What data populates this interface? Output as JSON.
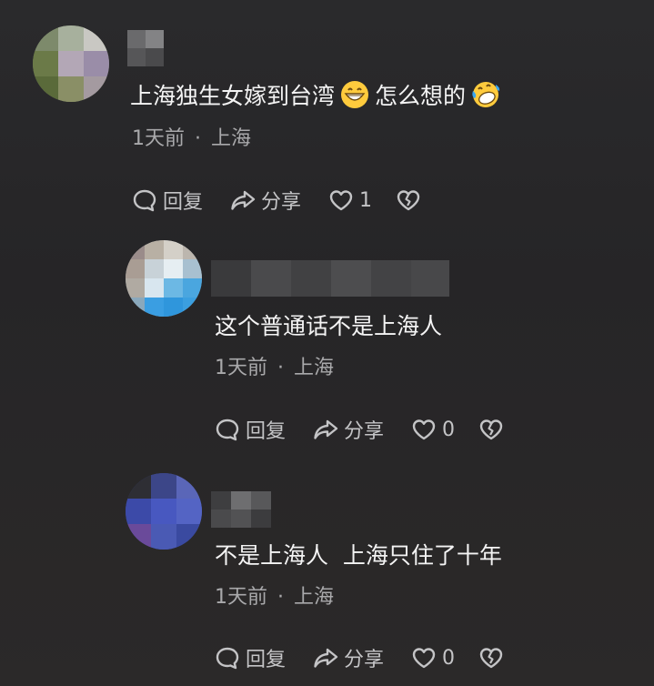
{
  "comments": [
    {
      "text": "上海独生女嫁到台湾",
      "text_after": "怎么想的",
      "time": "1天前",
      "sep": "·",
      "location": "上海",
      "reply_label": "回复",
      "share_label": "分享",
      "like_count": "1"
    },
    {
      "text": "这个普通话不是上海人",
      "time": "1天前",
      "sep": "·",
      "location": "上海",
      "reply_label": "回复",
      "share_label": "分享",
      "like_count": "0"
    },
    {
      "text": "不是上海人  上海只住了十年",
      "time": "1天前",
      "sep": "·",
      "location": "上海",
      "reply_label": "回复",
      "share_label": "分享",
      "like_count": "0"
    }
  ],
  "icons": {
    "reply": "reply-icon",
    "share": "share-icon",
    "like": "heart-icon",
    "dislike": "broken-heart-icon",
    "emoji1": "grinning-emoji",
    "emoji2": "laughing-tears-emoji"
  },
  "colors": {
    "background": "#282729",
    "text": "#f4f4f4",
    "meta": "#a9a9ab",
    "action": "#c4c4c6"
  }
}
